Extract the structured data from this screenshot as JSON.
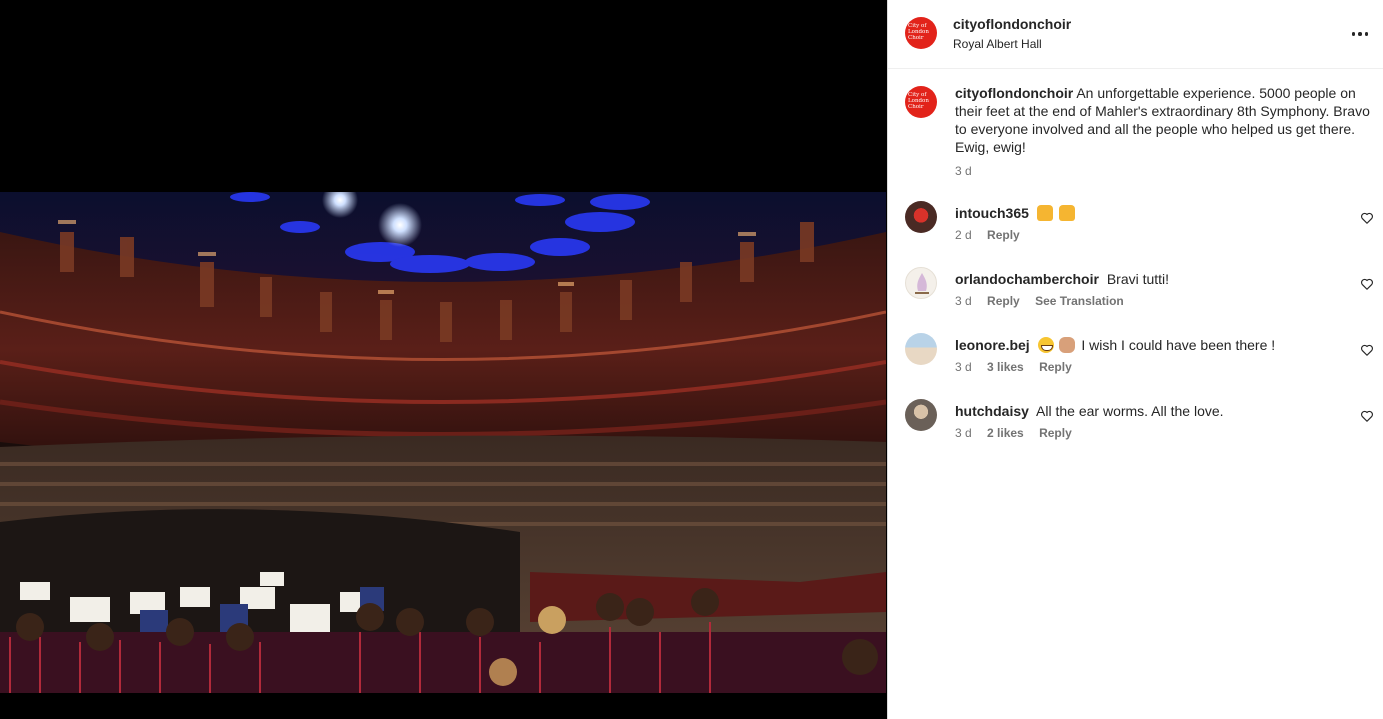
{
  "post": {
    "username": "cityoflondonchoir",
    "location": "Royal Albert Hall",
    "logo_text": "City of London Choir",
    "caption": {
      "username": "cityoflondonchoir",
      "text": "An unforgettable experience. 5000 people on their feet at the end of Mahler's extraordinary 8th Symphony. Bravo to everyone involved and all the people who helped us get there. Ewig, ewig!",
      "time": "3 d"
    }
  },
  "comments": [
    {
      "username": "intouch365",
      "text": "",
      "emojis": [
        "hands",
        "hands"
      ],
      "time": "2 d",
      "likes": "",
      "reply": "Reply",
      "translate": ""
    },
    {
      "username": "orlandochamberchoir",
      "text": "Bravi tutti!",
      "emojis": [],
      "time": "3 d",
      "likes": "",
      "reply": "Reply",
      "translate": "See Translation"
    },
    {
      "username": "leonore.bej",
      "text": "I wish I could have been there !",
      "emojis": [
        "grin",
        "clap"
      ],
      "time": "3 d",
      "likes": "3 likes",
      "reply": "Reply",
      "translate": ""
    },
    {
      "username": "hutchdaisy",
      "text": "All the ear worms. All the love.",
      "emojis": [],
      "time": "3 d",
      "likes": "2 likes",
      "reply": "Reply",
      "translate": ""
    }
  ],
  "colors": {
    "brand_red": "#e2231a",
    "secondary_text": "#737373"
  }
}
